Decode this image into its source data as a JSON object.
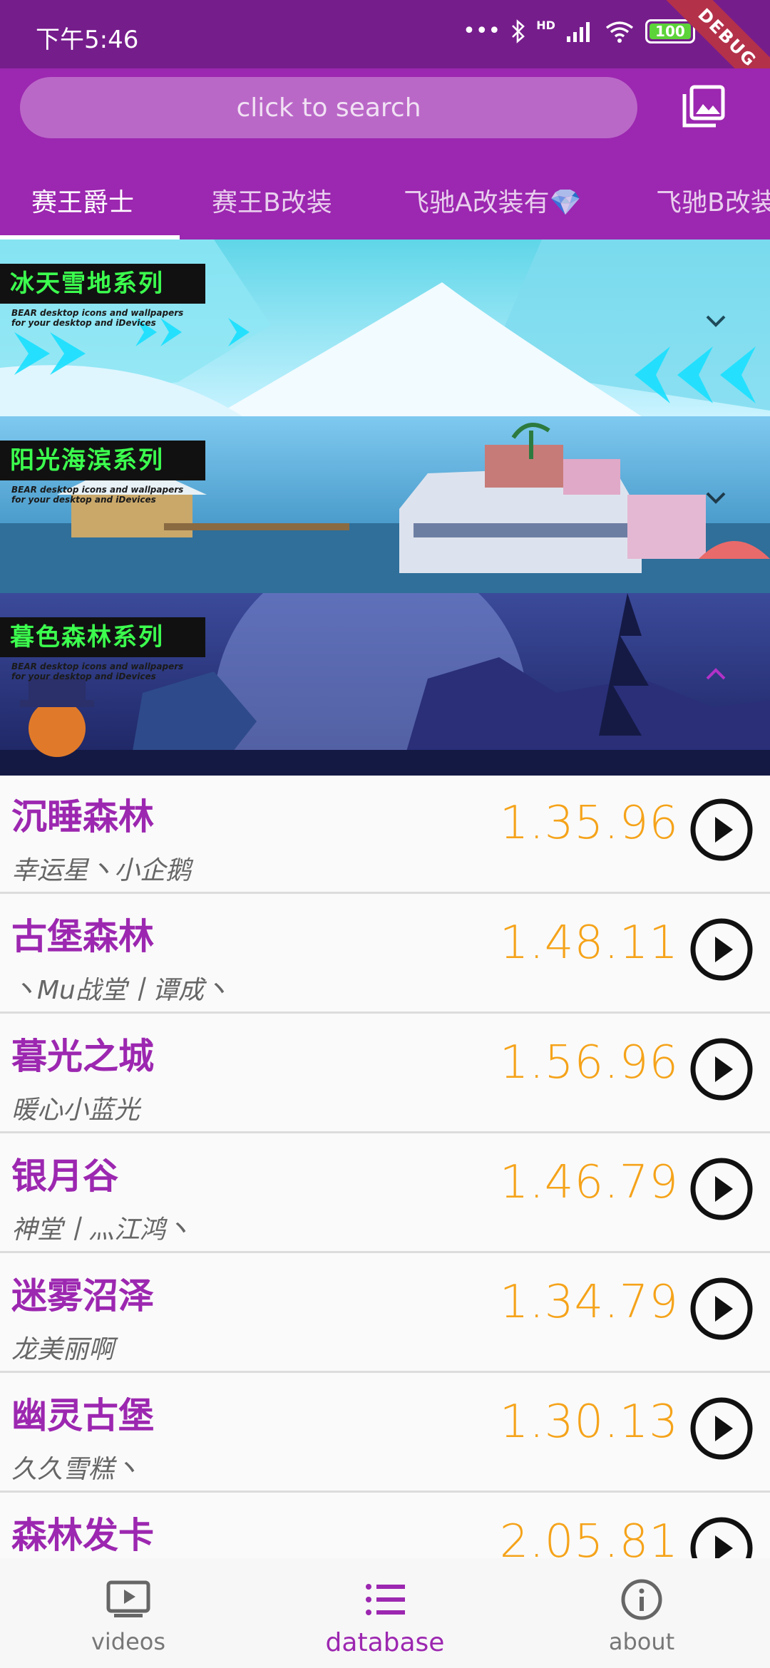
{
  "status_bar": {
    "time": "下午5:46",
    "signal_text": "HD",
    "battery": "100",
    "debug_label": "DEBUG"
  },
  "search": {
    "placeholder": "click to search"
  },
  "tabs": [
    {
      "label": "赛王爵士",
      "active": true
    },
    {
      "label": "赛王B改装",
      "active": false
    },
    {
      "label": "飞驰A改装有💎",
      "active": false
    },
    {
      "label": "飞驰B改装",
      "active": false
    }
  ],
  "banners": [
    {
      "title": "冰天雪地系列",
      "subtitle_line1": "BEAR desktop icons and wallpapers",
      "subtitle_line2": "for your desktop and iDevices",
      "expanded": false
    },
    {
      "title": "阳光海滨系列",
      "subtitle_line1": "BEAR desktop icons and wallpapers",
      "subtitle_line2": "for your desktop and iDevices",
      "expanded": false
    },
    {
      "title": "暮色森林系列",
      "subtitle_line1": "BEAR desktop icons and wallpapers",
      "subtitle_line2": "for your desktop and iDevices",
      "expanded": true
    }
  ],
  "tracks": [
    {
      "name": "沉睡森林",
      "player": "幸运星丶小企鹅",
      "time": "1.35.96"
    },
    {
      "name": "古堡森林",
      "player": "丶Mu战堂丨谭成丶",
      "time": "1.48.11"
    },
    {
      "name": "暮光之城",
      "player": "暖心小蓝光",
      "time": "1.56.96"
    },
    {
      "name": "银月谷",
      "player": "神堂丨灬江鸿丶",
      "time": "1.46.79"
    },
    {
      "name": "迷雾沼泽",
      "player": "龙美丽啊",
      "time": "1.34.79"
    },
    {
      "name": "幽灵古堡",
      "player": "久久雪糕丶",
      "time": "1.30.13"
    },
    {
      "name": "森林发卡",
      "player": "",
      "time": "2.05.81"
    }
  ],
  "bottom_nav": [
    {
      "label": "videos",
      "icon": "video-icon",
      "active": false
    },
    {
      "label": "database",
      "icon": "list-icon",
      "active": true
    },
    {
      "label": "about",
      "icon": "info-icon",
      "active": false
    }
  ],
  "colors": {
    "primary": "#9c27b0",
    "status_bar": "#761d8c",
    "time_accent": "#f5a31a",
    "banner_title": "#3cff4e"
  }
}
